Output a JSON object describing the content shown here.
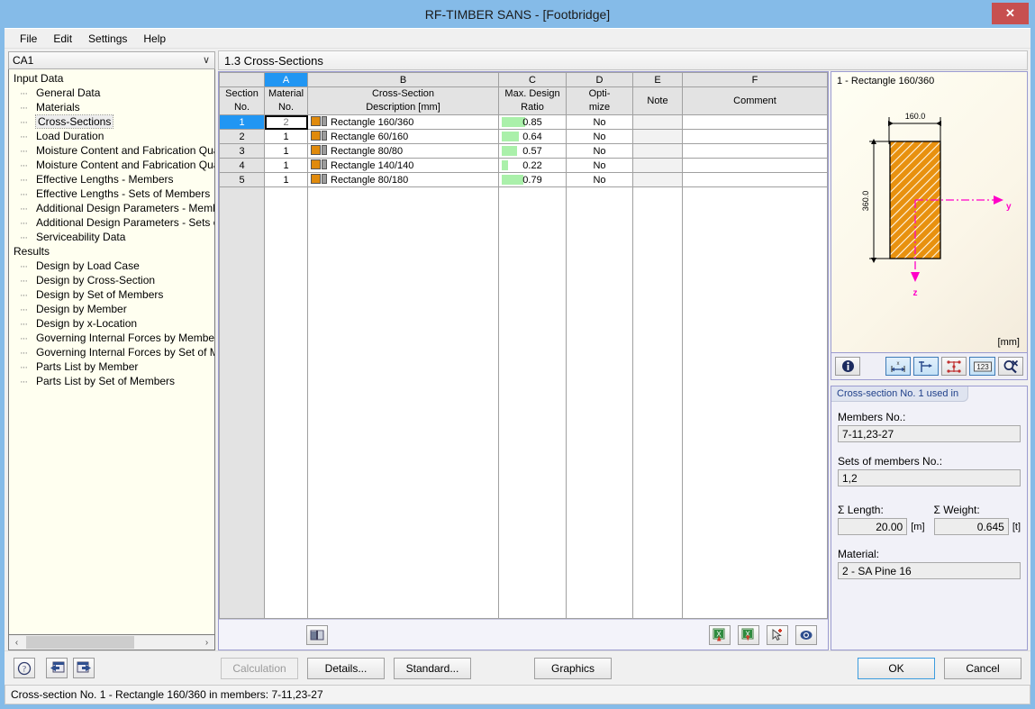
{
  "window": {
    "title": "RF-TIMBER SANS - [Footbridge]",
    "close_label": "✕"
  },
  "menubar": {
    "items": [
      {
        "label": "File"
      },
      {
        "label": "Edit"
      },
      {
        "label": "Settings"
      },
      {
        "label": "Help"
      }
    ]
  },
  "sidebar": {
    "case_selector": {
      "value": "CA1",
      "chevron": "∨"
    },
    "groups": [
      {
        "label": "Input Data",
        "items": [
          {
            "label": "General Data",
            "selected": false
          },
          {
            "label": "Materials",
            "selected": false
          },
          {
            "label": "Cross-Sections",
            "selected": true
          },
          {
            "label": "Load Duration",
            "selected": false
          },
          {
            "label": "Moisture Content and Fabrication Quality",
            "selected": false
          },
          {
            "label": "Moisture Content and Fabrication Quality",
            "selected": false
          },
          {
            "label": "Effective Lengths - Members",
            "selected": false
          },
          {
            "label": "Effective Lengths - Sets of Members",
            "selected": false
          },
          {
            "label": "Additional Design Parameters - Members",
            "selected": false
          },
          {
            "label": "Additional Design Parameters - Sets of Me",
            "selected": false
          },
          {
            "label": "Serviceability Data",
            "selected": false
          }
        ]
      },
      {
        "label": "Results",
        "items": [
          {
            "label": "Design by Load Case",
            "selected": false
          },
          {
            "label": "Design by Cross-Section",
            "selected": false
          },
          {
            "label": "Design by Set of Members",
            "selected": false
          },
          {
            "label": "Design by Member",
            "selected": false
          },
          {
            "label": "Design by x-Location",
            "selected": false
          },
          {
            "label": "Governing Internal Forces by Member",
            "selected": false
          },
          {
            "label": "Governing Internal Forces by Set of Mem",
            "selected": false
          },
          {
            "label": "Parts List by Member",
            "selected": false
          },
          {
            "label": "Parts List by Set of Members",
            "selected": false
          }
        ]
      }
    ],
    "scroll_left": "‹",
    "scroll_right": "›"
  },
  "main": {
    "section_title": "1.3 Cross-Sections"
  },
  "table": {
    "column_letters": [
      "",
      "A",
      "B",
      "C",
      "D",
      "E",
      "F"
    ],
    "active_column": "A",
    "headers": [
      {
        "line1": "Section",
        "line2": "No."
      },
      {
        "line1": "Material",
        "line2": "No."
      },
      {
        "line1": "Cross-Section",
        "line2": "Description [mm]"
      },
      {
        "line1": "Max. Design",
        "line2": "Ratio"
      },
      {
        "line1": "Opti-",
        "line2": "mize"
      },
      {
        "line1": "",
        "line2": "Note"
      },
      {
        "line1": "",
        "line2": "Comment"
      }
    ],
    "rows": [
      {
        "section_no": "1",
        "material_no": "2",
        "description": "Rectangle 160/360",
        "ratio": "0.85",
        "ratio_value": 0.85,
        "optimize": "No",
        "note": "",
        "comment": "",
        "selected": true
      },
      {
        "section_no": "2",
        "material_no": "1",
        "description": "Rectangle 60/160",
        "ratio": "0.64",
        "ratio_value": 0.64,
        "optimize": "No",
        "note": "",
        "comment": "",
        "selected": false
      },
      {
        "section_no": "3",
        "material_no": "1",
        "description": "Rectangle 80/80",
        "ratio": "0.57",
        "ratio_value": 0.57,
        "optimize": "No",
        "note": "",
        "comment": "",
        "selected": false
      },
      {
        "section_no": "4",
        "material_no": "1",
        "description": "Rectangle 140/140",
        "ratio": "0.22",
        "ratio_value": 0.22,
        "optimize": "No",
        "note": "",
        "comment": "",
        "selected": false
      },
      {
        "section_no": "5",
        "material_no": "1",
        "description": "Rectangle 80/180",
        "ratio": "0.79",
        "ratio_value": 0.79,
        "optimize": "No",
        "note": "",
        "comment": "",
        "selected": false
      }
    ],
    "toolbar": {
      "library_icon": "library-book-icon",
      "import_excel_icon": "import-from-excel-icon",
      "export_excel_icon": "export-to-excel-icon",
      "pick_icon": "pick-from-model-icon",
      "view_icon": "view-mode-icon"
    }
  },
  "cross_section_view": {
    "title": "1 - Rectangle 160/360",
    "unit_label": "[mm]",
    "width_dim": "160.0",
    "height_dim": "360.0",
    "axis_y_label": "y",
    "axis_z_label": "z",
    "fill_color": "#E08A0C",
    "axis_color": "#FF00C8",
    "toolbar_buttons": [
      {
        "name": "info-icon",
        "active": false
      },
      {
        "name": "dimension-x-icon",
        "active": true
      },
      {
        "name": "axes-icon",
        "active": true
      },
      {
        "name": "stress-points-icon",
        "active": false
      },
      {
        "name": "numbering-icon",
        "active": true
      },
      {
        "name": "zoom-reset-icon",
        "active": false
      }
    ]
  },
  "info_panel": {
    "title": "Cross-section No. 1 used in",
    "members_label": "Members No.:",
    "members_value": "7-11,23-27",
    "sets_label": "Sets of members No.:",
    "sets_value": "1,2",
    "length_label": "Σ Length:",
    "length_value": "20.00",
    "length_unit": "[m]",
    "weight_label": "Σ Weight:",
    "weight_value": "0.645",
    "weight_unit": "[t]",
    "material_label": "Material:",
    "material_value": "2 - SA Pine 16"
  },
  "bottom_bar": {
    "help_icon": "help-question-icon",
    "prev_icon": "previous-window-icon",
    "next_icon": "next-window-icon",
    "calculation_label": "Calculation",
    "details_label": "Details...",
    "standard_label": "Standard...",
    "graphics_label": "Graphics",
    "ok_label": "OK",
    "cancel_label": "Cancel"
  },
  "statusbar": {
    "text": "Cross-section No. 1 - Rectangle 160/360 in members: 7-11,23-27"
  }
}
